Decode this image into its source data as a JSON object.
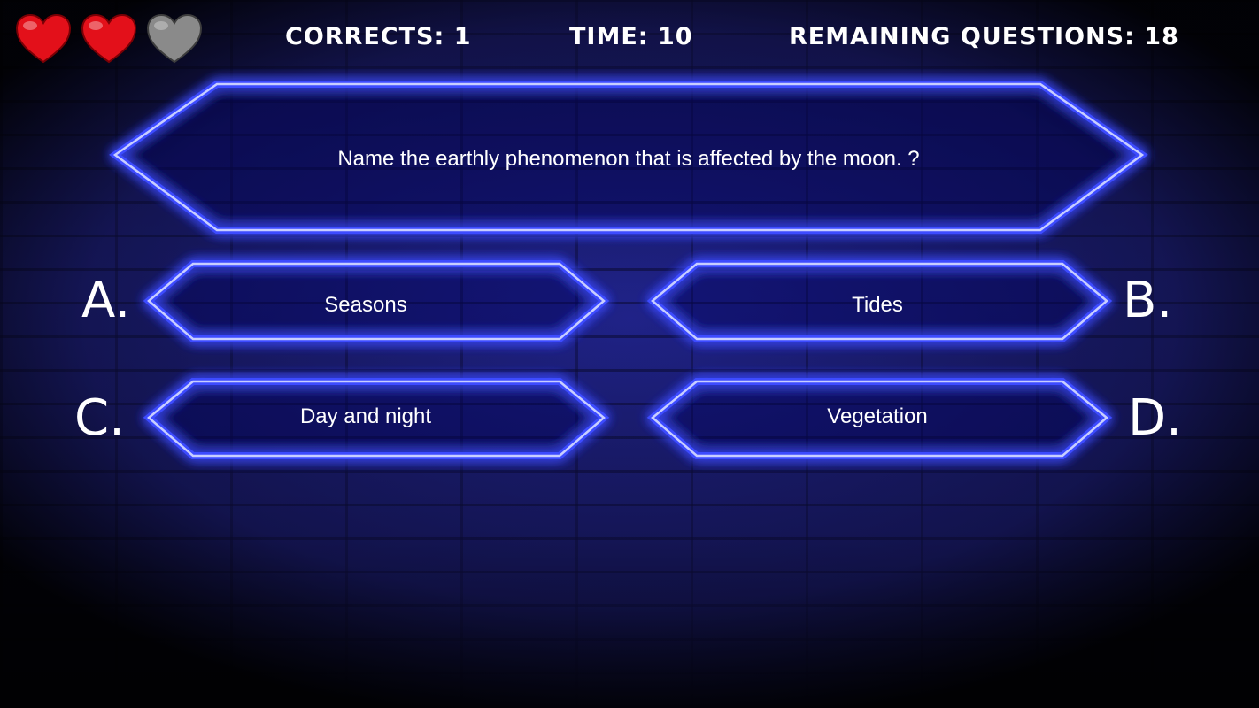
{
  "hud": {
    "lives_total": 3,
    "lives_remaining": 2,
    "corrects_label": "Corrects:",
    "corrects_value": "1",
    "time_label": "Time:",
    "time_value": "10",
    "remaining_label": "Remaining Questions:",
    "remaining_value": "18"
  },
  "colors": {
    "heart_full": "#e3101a",
    "heart_empty": "#8a8a8a",
    "neon_frame": "#3c4cff",
    "text": "#ffffff"
  },
  "question": {
    "text": "Name the earthly phenomenon that is affected by the moon. ?"
  },
  "answers": [
    {
      "letter": "A.",
      "text": "Seasons"
    },
    {
      "letter": "B.",
      "text": "Tides"
    },
    {
      "letter": "C.",
      "text": "Day and night"
    },
    {
      "letter": "D.",
      "text": "Vegetation"
    }
  ]
}
